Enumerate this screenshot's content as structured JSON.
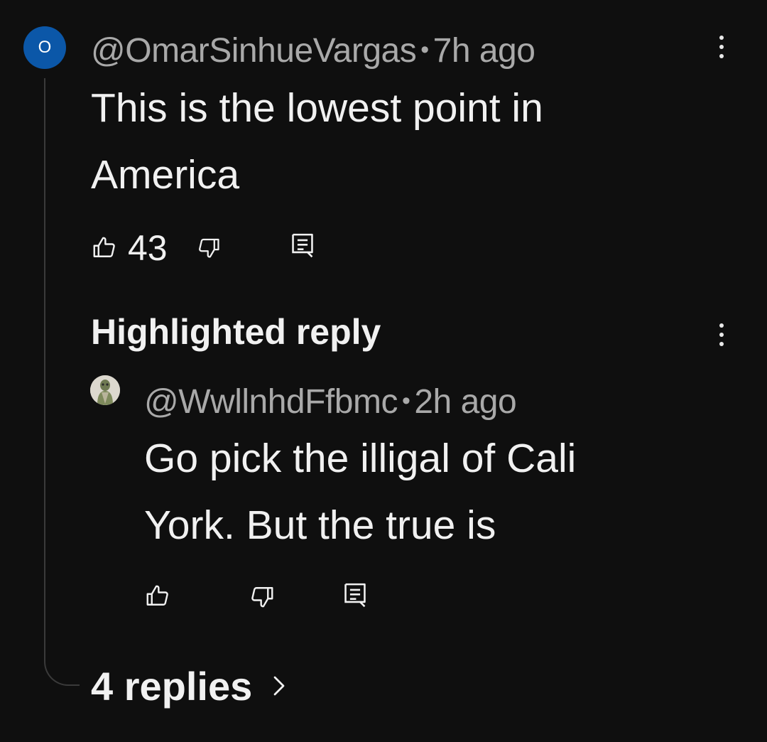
{
  "comment": {
    "avatar_letter": "O",
    "avatar_color": "#0b57a8",
    "author": "@OmarSinhueVargas",
    "separator": "•",
    "time": "7h ago",
    "text_line1": "This is the lowest point in",
    "text_line2": "America",
    "like_count": "43",
    "icons": {
      "like": "thumbs-up-icon",
      "dislike": "thumbs-down-icon",
      "reply": "reply-comment-icon",
      "menu": "more-vert-icon"
    }
  },
  "highlighted": {
    "label": "Highlighted reply",
    "author": "@WwllnhdFfbmc",
    "separator": "•",
    "time": "2h ago",
    "text_line1": "Go pick the illigal of Cali",
    "text_line2": "York. But the true is"
  },
  "replies": {
    "label": "4 replies",
    "chevron": "›"
  }
}
